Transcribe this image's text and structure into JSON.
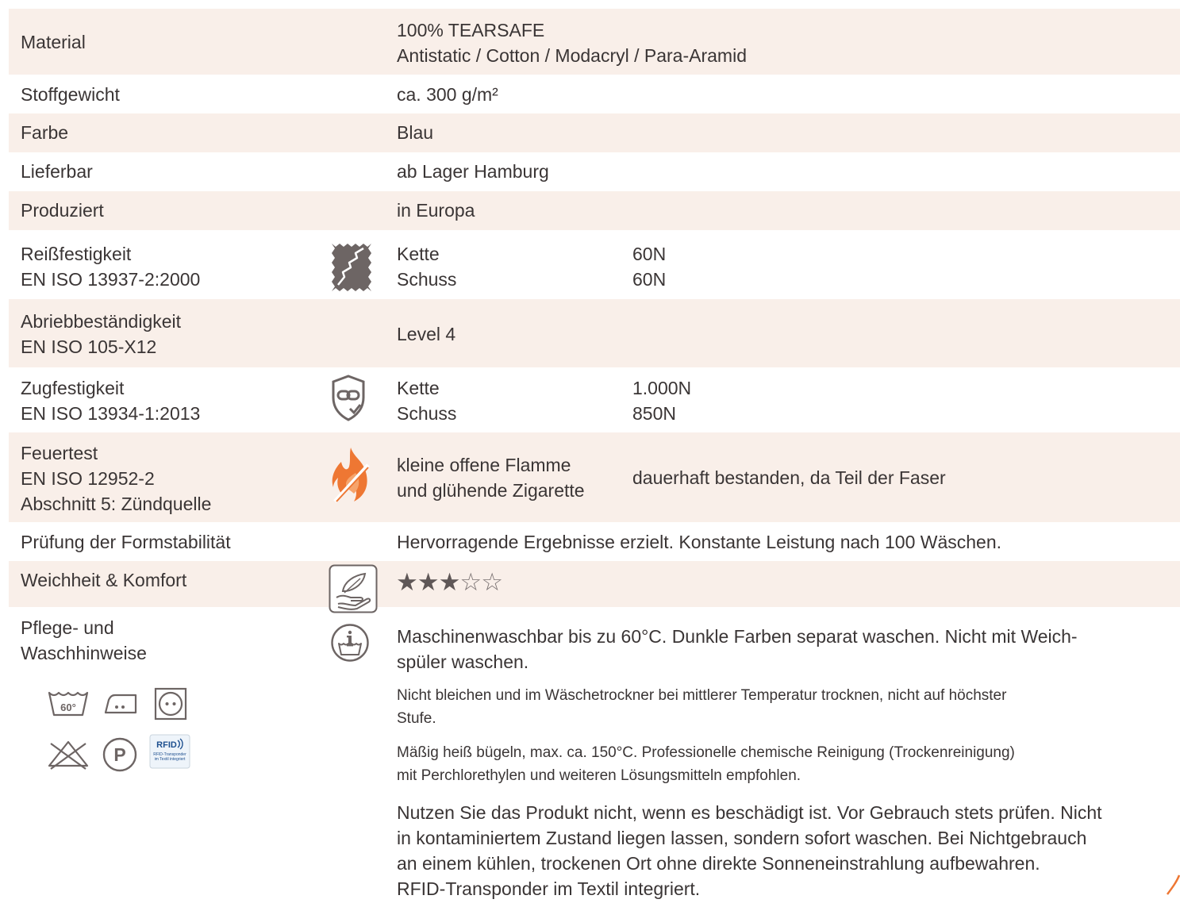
{
  "rows": {
    "material": {
      "label": "Material",
      "value_1": "100% TEARSAFE",
      "value_2": "Antistatic / Cotton / Modacryl / Para-Aramid"
    },
    "weight": {
      "label": "Stoffgewicht",
      "value": "ca. 300 g/m²"
    },
    "color": {
      "label": "Farbe",
      "value": "Blau"
    },
    "delivery": {
      "label": "Lieferbar",
      "value": "ab Lager Hamburg"
    },
    "produced": {
      "label": "Produziert",
      "value": "in Europa"
    },
    "tear": {
      "label_1": "Reißfestigkeit",
      "label_2": "EN ISO 13937-2:2000",
      "icon": "torn-fabric-icon",
      "k1": "Kette",
      "k2": "Schuss",
      "v1": "60N",
      "v2": "60N"
    },
    "abrasion": {
      "label_1": "Abriebbeständigkeit",
      "label_2": "EN ISO 105-X12",
      "value": "Level 4"
    },
    "tensile": {
      "label_1": "Zugfestigkeit",
      "label_2": "EN ISO 13934-1:2013",
      "icon": "shield-chain-icon",
      "k1": "Kette",
      "k2": "Schuss",
      "v1": "1.000N",
      "v2": "850N"
    },
    "fire": {
      "label_1": "Feuertest",
      "label_2": "EN ISO 12952-2",
      "label_3": "Abschnitt 5: Zündquelle",
      "icon": "flame-icon",
      "value_1": "kleine offene Flamme",
      "value_2": "und glühende Zigarette",
      "result": "dauerhaft bestanden, da Teil der Faser"
    },
    "stability": {
      "label": "Prüfung der Formstabilität",
      "value": "Hervorragende Ergebnisse erzielt. Konstante Leistung nach 100 Wäschen."
    },
    "softness": {
      "label": "Weichheit & Komfort",
      "icon": "feather-hand-icon",
      "rating": 3,
      "rating_max": 5
    },
    "care": {
      "label_1": "Pflege- und",
      "label_2": "Waschhinweise",
      "icon": "wash-info-icon",
      "p1_line1": "Maschinenwaschbar bis zu 60°C. Dunkle Farben separat waschen. Nicht mit Weich-",
      "p1_line2": "spüler waschen.",
      "p2_line1": "Nicht bleichen und im Wäschetrockner bei mittlerer Temperatur trocknen, nicht auf höchster",
      "p2_line2": "Stufe.",
      "p3_line1": "Mäßig heiß bügeln, max. ca. 150°C. Professionelle chemische Reinigung (Trockenreinigung)",
      "p3_line2": "mit Perchlorethylen und weiteren Lösungsmitteln empfohlen.",
      "p4_line1": "Nutzen Sie das Produkt nicht, wenn es beschädigt ist. Vor Gebrauch stets prüfen. Nicht",
      "p4_line2": "in kontaminiertem Zustand liegen lassen, sondern sofort waschen. Bei Nichtgebrauch",
      "p4_line3": "an einem kühlen, trockenen Ort ohne direkte Sonneneinstrahlung aufbewahren.",
      "p4_line4": "RFID-Transponder im Textil integriert.",
      "symbols": {
        "wash": "60°",
        "professional": "P",
        "rfid_title": "RFID",
        "rfid_sub1": "RFID-Transponder",
        "rfid_sub2": "im Textil integriert"
      }
    }
  },
  "colors": {
    "row_shade": "#f9efe9",
    "text": "#3a3535",
    "icon": "#6d6564",
    "flame": "#ee7733"
  }
}
